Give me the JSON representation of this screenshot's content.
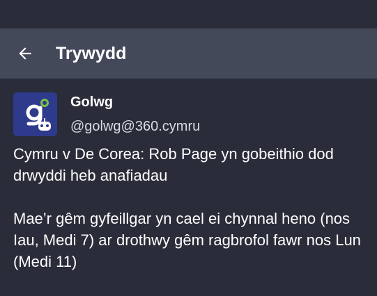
{
  "app_bar": {
    "title": "Trywydd",
    "back_icon": "arrow-left-icon"
  },
  "post": {
    "avatar": {
      "icon": "golwg-logo-icon",
      "background": "#2e3a8c",
      "accent": "#7ac142"
    },
    "display_name": "Golwg",
    "account": "@golwg@360.cymru",
    "paragraphs": [
      "Cymru v De Corea: Rob Page yn gobeithio dod drwyddi heb anafiadau",
      "Mae’r gêm gyfeillgar yn cael ei chynnal heno (nos Iau, Medi 7) ar drothwy gêm ragbrofol fawr nos Lun (Medi 11)"
    ]
  },
  "colors": {
    "background": "#2a2d39",
    "app_bar": "#44495a",
    "text": "#ffffff",
    "secondary_text": "#d9dbe3"
  }
}
